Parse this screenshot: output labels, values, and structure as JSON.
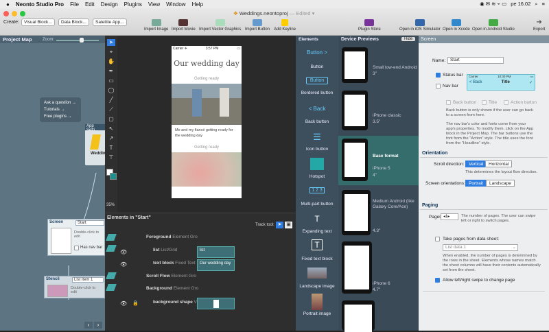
{
  "menubar": {
    "apple": "",
    "app": "Neonto Studio Pro",
    "items": [
      "File",
      "Edit",
      "Design",
      "Plugins",
      "View",
      "Window",
      "Help"
    ],
    "time": "pe 16.02"
  },
  "window": {
    "title": "Weddings.neontoproj",
    "status": "— Edited ▾"
  },
  "toolbar": {
    "create_label": "Create:",
    "create_buttons": [
      "Visual Block...",
      "Data Block...",
      "Satellite App..."
    ],
    "tools": [
      "Import Image",
      "Import Movie",
      "Import Vector Graphics",
      "Import Button",
      "Add Keyline"
    ],
    "right_tools": [
      "Plugin Store",
      "Open in iOS Simulator",
      "Open in Xcode",
      "Open in Android Studio",
      "Export"
    ]
  },
  "project_map": {
    "title": "Project Map",
    "zoom_label": "Zoom:",
    "help_links": [
      "Ask a question →",
      "Tutorials →",
      "Free plugins →"
    ],
    "app_settings": "App Setti...",
    "wedding_label": "Weddin...",
    "screen_block": {
      "title": "Screen",
      "name": "Start",
      "hint": "Double-click to edit",
      "navbar": "Has nav bar"
    },
    "stencil_block": {
      "title": "Stencil",
      "name": "List item 1",
      "hint": "Double-click to edit"
    }
  },
  "canvas": {
    "zoom": "35%",
    "phone": {
      "carrier": "Carrier ✈",
      "time": "3:57 PM",
      "title": "Our wedding day",
      "subtitle": "Getting ready",
      "body": "Me and my fiancé getting ready for the wedding day",
      "subtitle2": "Getting ready"
    }
  },
  "elements_in_start": {
    "title": "Elements in \"Start\"",
    "track_tool": "Track tool:",
    "rows": [
      {
        "name": "Foreground",
        "type": "Element Gro"
      },
      {
        "name": "list",
        "type": "List/Grid",
        "swatch": "list"
      },
      {
        "name": "text block",
        "type": "Fixed Text",
        "swatch": "Our wedding day"
      },
      {
        "name": "Scroll Flow",
        "type": "Element Gro"
      },
      {
        "name": "Background",
        "type": "Element Gro"
      },
      {
        "name": "background shape",
        "type": "Ve"
      }
    ]
  },
  "palette": {
    "title": "Elements",
    "items": [
      {
        "preview": "Button >",
        "label": "Button"
      },
      {
        "preview": "Button",
        "label": "Bordered button"
      },
      {
        "preview": "< Back",
        "label": "Back button"
      },
      {
        "preview": "☰",
        "label": "Icon button"
      },
      {
        "preview": "",
        "label": "Hotspot"
      },
      {
        "preview": "1 2 3",
        "label": "Multi-part button"
      },
      {
        "preview": "T",
        "label": "Expanding text"
      },
      {
        "preview": "T",
        "label": "Fixed text block"
      },
      {
        "preview": "",
        "label": "Landscape image"
      },
      {
        "preview": "",
        "label": "Portrait image"
      }
    ]
  },
  "devices": {
    "title": "Device Previews",
    "hide": "Hide",
    "items": [
      {
        "name": "Small low-end Android",
        "size": "3\""
      },
      {
        "name": "iPhone classic",
        "size": "3.5\""
      },
      {
        "name": "Base format",
        "sub": "iPhone 5",
        "size": "4\""
      },
      {
        "name": "Medium Android (like Galaxy Core/Ace)",
        "size": "4.3\""
      },
      {
        "name": "iPhone 6",
        "size": "4.7\""
      }
    ]
  },
  "inspector": {
    "header": "Screen",
    "name_label": "Name:",
    "name_value": "Start",
    "status_bar": "Status bar",
    "nav_bar": "Nav bar",
    "nav_preview": {
      "carrier": "Carrier",
      "time": "10:30 PM",
      "back": "< Back",
      "title": "Title"
    },
    "nav_checks": [
      "Back button",
      "Title",
      "Action button"
    ],
    "nav_help1": "Back button is only shown if the user can go back to a screen from here.",
    "nav_help2": "The nav bar's color and fonts come from your app's properties. To modify them, click on the App block in the Project Map. The bar buttons use the font from the \"Action\" style. The title uses the font from the \"Headline\" style.",
    "orientation_head": "Orientation",
    "scroll_label": "Scroll direction:",
    "scroll_opts": [
      "Vertical",
      "Horizontal"
    ],
    "scroll_help": "This determines the layout flow direction.",
    "orient_label": "Screen orientations:",
    "orient_opts": [
      "Portrait",
      "Landscape"
    ],
    "paging_head": "Paging",
    "pages_label": "Pages:",
    "pages_value": "1",
    "pages_help": "The number of pages. The user can swipe left or right to switch pages.",
    "take_pages": "Take pages from data sheet:",
    "data_sheet": "List data 1",
    "data_help": "When enabled, the number of pages is determined by the rows in the sheet. Elements whose names match the sheet columns will have their contents automatically set from the sheet.",
    "swipe": "Allow left/right swipe to change page"
  }
}
